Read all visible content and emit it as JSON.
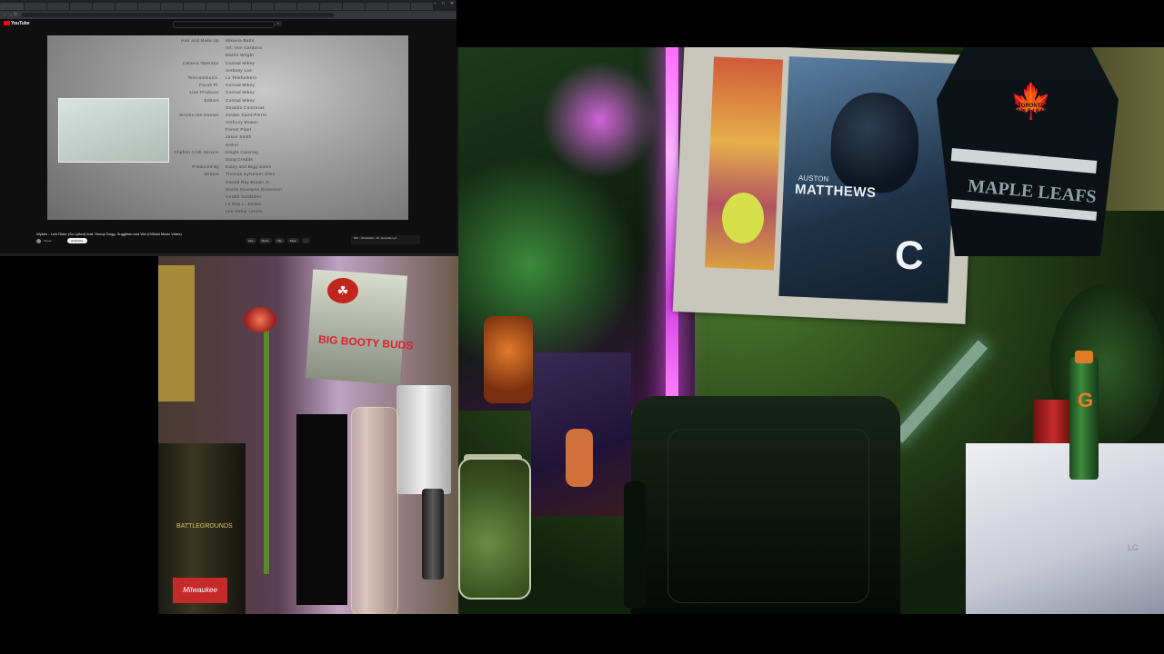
{
  "browser": {
    "tabs": [
      "",
      "",
      "",
      "",
      "",
      "",
      "",
      "",
      "",
      "",
      "",
      "",
      "",
      "",
      "",
      "",
      "",
      "",
      ""
    ],
    "url": "",
    "site_name": "YouTube",
    "search_placeholder": "",
    "window_controls": [
      "–",
      "□",
      "✕"
    ]
  },
  "video": {
    "title": "Wysen - Low Rider (So Lyfted) feat. Snoop Dogg, Suggfisto and Wiz (Official Music Video)",
    "channel": "Wysen",
    "subscribe_label": "Subscribe",
    "actions": [
      "Like",
      "Share",
      "Clip",
      "Save",
      "···"
    ],
    "credits": [
      {
        "role": "Hair and Make Up",
        "name": "Mikaela Batts"
      },
      {
        "role": "",
        "name": "Art: Von Cardona"
      },
      {
        "role": "",
        "name": "Martin Wright"
      },
      {
        "role": "Camera Operator",
        "name": "Conrad Mikey"
      },
      {
        "role": "",
        "name": "Anthony Lee"
      },
      {
        "role": "Telecommunic.",
        "name": "La Telefunkero"
      },
      {
        "role": "Focus Pl.",
        "name": "Conrad Mikey"
      },
      {
        "role": "Line Producer",
        "name": "Conrad Mikey"
      },
      {
        "role": "Editors",
        "name": "Conrad Mikey"
      },
      {
        "role": "",
        "name": "Geraldo Contreras"
      },
      {
        "role": "Jerome the Gunner",
        "name": "Jordan Saint-Pierre"
      },
      {
        "role": "",
        "name": "Anthony Bowen"
      },
      {
        "role": "",
        "name": "Forest Plant"
      },
      {
        "role": "",
        "name": "Jason Smith"
      },
      {
        "role": "",
        "name": "Siskel"
      },
      {
        "role": "Clipfilm Craft Service",
        "name": "Knight Catering"
      },
      {
        "role": "",
        "name": "Song Credits"
      },
      {
        "role": "Produced By",
        "name": "Kutzy and Bigg Justin"
      },
      {
        "role": "Writers",
        "name": "Thomas Sylvester Allen"
      },
      {
        "role": "",
        "name": "Harold Ray Brown Jr."
      },
      {
        "role": "",
        "name": "Morris Dewayne Dickerson"
      },
      {
        "role": "",
        "name": "Gerald Goldstein"
      },
      {
        "role": "",
        "name": "Le Roy L. Jordan"
      },
      {
        "role": "",
        "name": "Lee Oskar Levitin"
      }
    ],
    "up_next_title": "Wiz – Dimeback – Dr. (Juvenile Lyf...",
    "up_next_sub": "",
    "meta_line": ""
  },
  "webcam": {
    "poster_first_name": "AUSTON",
    "poster_last_name": "MATTHEWS",
    "poster_captain": "C",
    "jersey_text": "MAPLE LEAFS",
    "jersey_logo_text": "TORONTO MAPLE LEAFS",
    "chip_bag_text": "BIG BOOTY BUDS",
    "tin_label": "Milwaukee",
    "tin_text": "BATTLEGROUNDS",
    "fridge_logo": "LG",
    "drink_logo": "G",
    "poster_caption": "",
    "icons": [
      "maple-leaf-icon",
      "cannabis-leaf-icon"
    ]
  },
  "colors": {
    "youtube_red": "#ff0000",
    "led_pink": "#ff6cff",
    "leafs_blue": "#0d1418"
  }
}
